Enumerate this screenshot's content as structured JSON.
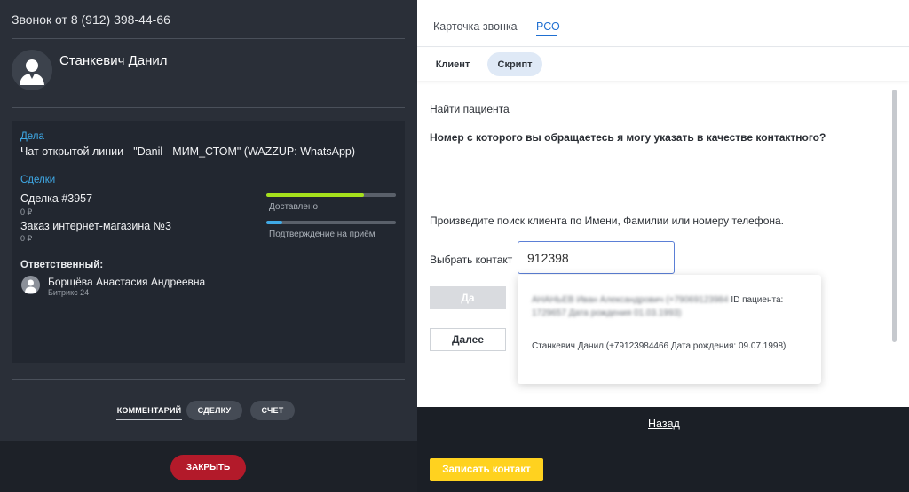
{
  "left": {
    "call_title": "Звонок от 8 (912) 398-44-66",
    "contact_name": "Станкевич Данил",
    "cases_label": "Дела",
    "case_item": "Чат открытой линии - \"Danil - МИМ_СТОМ\" (WAZZUP: WhatsApp)",
    "deals_label": "Сделки",
    "deals": [
      {
        "title": "Сделка #3957",
        "amount": "0 ₽",
        "status": "Доставлено",
        "progress": 0.75,
        "bar_color": "#a5e01c"
      },
      {
        "title": "Заказ интернет-магазина №3",
        "amount": "0 ₽",
        "status": "Подтверждение на приём",
        "progress": 0.12,
        "bar_color": "#3fa9e6"
      }
    ],
    "responsible_label": "Ответственный:",
    "responsible_name": "Борщёва Анастасия Андреевна",
    "responsible_company": "Битрикс 24",
    "tabs": {
      "comment": "КОММЕНТАРИЙ",
      "deal": "СДЕЛКУ",
      "invoice": "СЧЕТ"
    },
    "close_label": "ЗАКРЫТЬ"
  },
  "right": {
    "tabs": {
      "call_card": "Карточка звонка",
      "rso": "РСО"
    },
    "subtabs": {
      "client": "Клиент",
      "script": "Скрипт"
    },
    "find_patient": "Найти пациента",
    "question": "Номер с которого вы обращаетесь я могу указать в качестве контактного?",
    "instruction": "Произведите поиск клиента по Имени, Фамилии или номеру телефона.",
    "select_contact_label": "Выбрать контакт",
    "search_value": "912398",
    "yes_label": "Да",
    "next_label": "Далее",
    "dropdown": [
      {
        "text": "АНАНЬЕВ Иван Александрович (+79069123984 ID пациента: 1729657 Дата рождения 01.03.1993)",
        "blurred_part": "АНАНЬЕВ Иван Александрович (+79069123984",
        "clear_part": " ID пациента:",
        "blurred_line2": "1729657 Дата рождения 01.03.1993)"
      },
      {
        "text": "Станкевич Данил (+79123984466 Дата рождения: 09.07.1998)"
      }
    ],
    "back_label": "Назад",
    "save_label": "Записать контакт"
  },
  "colors": {
    "accent_blue": "#1f6fd1",
    "close_red": "#b31a2a",
    "save_yellow": "#ffd21f",
    "label_blue": "#3fa9e6"
  }
}
